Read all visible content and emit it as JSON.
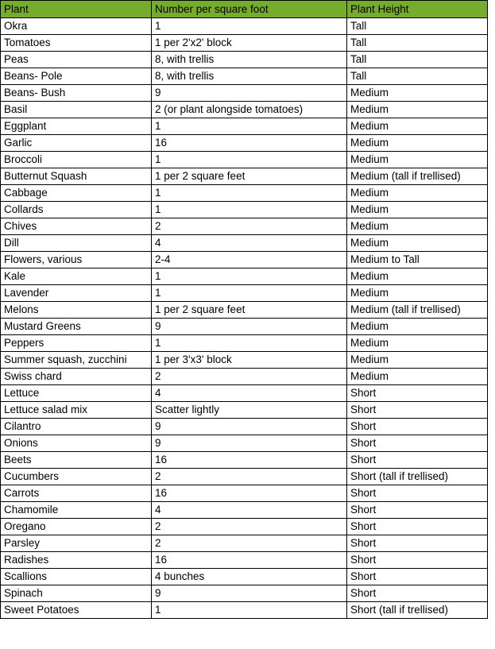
{
  "table": {
    "columns": [
      {
        "key": "plant",
        "label": "Plant"
      },
      {
        "key": "number",
        "label": "Number per square foot"
      },
      {
        "key": "height",
        "label": "Plant Height"
      }
    ],
    "header_background": "#76ac2c",
    "border_color": "#000000",
    "rows": [
      {
        "plant": "Okra",
        "number": "1",
        "height": "Tall"
      },
      {
        "plant": "Tomatoes",
        "number": "1 per 2'x2' block",
        "height": "Tall"
      },
      {
        "plant": "Peas",
        "number": "8, with trellis",
        "height": "Tall"
      },
      {
        "plant": "Beans- Pole",
        "number": "8, with trellis",
        "height": "Tall"
      },
      {
        "plant": "Beans- Bush",
        "number": "9",
        "height": "Medium"
      },
      {
        "plant": "Basil",
        "number": "2 (or plant alongside tomatoes)",
        "height": "Medium"
      },
      {
        "plant": "Eggplant",
        "number": "1",
        "height": "Medium"
      },
      {
        "plant": "Garlic",
        "number": "16",
        "height": "Medium"
      },
      {
        "plant": "Broccoli",
        "number": "1",
        "height": "Medium"
      },
      {
        "plant": "Butternut Squash",
        "number": "1 per 2 square feet",
        "height": "Medium (tall if trellised)"
      },
      {
        "plant": "Cabbage",
        "number": "1",
        "height": "Medium"
      },
      {
        "plant": "Collards",
        "number": "1",
        "height": "Medium"
      },
      {
        "plant": "Chives",
        "number": "2",
        "height": "Medium"
      },
      {
        "plant": "Dill",
        "number": "4",
        "height": "Medium"
      },
      {
        "plant": "Flowers, various",
        "number": "2-4",
        "height": "Medium to Tall"
      },
      {
        "plant": "Kale",
        "number": "1",
        "height": "Medium"
      },
      {
        "plant": "Lavender",
        "number": "1",
        "height": "Medium"
      },
      {
        "plant": "Melons",
        "number": "1 per 2 square feet",
        "height": "Medium (tall if trellised)"
      },
      {
        "plant": "Mustard Greens",
        "number": "9",
        "height": "Medium"
      },
      {
        "plant": "Peppers",
        "number": "1",
        "height": "Medium"
      },
      {
        "plant": "Summer squash, zucchini",
        "number": "1 per 3'x3' block",
        "height": "Medium"
      },
      {
        "plant": "Swiss chard",
        "number": "2",
        "height": "Medium"
      },
      {
        "plant": "Lettuce",
        "number": "4",
        "height": "Short"
      },
      {
        "plant": "Lettuce salad mix",
        "number": "Scatter lightly",
        "height": "Short"
      },
      {
        "plant": "Cilantro",
        "number": "9",
        "height": "Short"
      },
      {
        "plant": "Onions",
        "number": "9",
        "height": "Short"
      },
      {
        "plant": "Beets",
        "number": "16",
        "height": "Short"
      },
      {
        "plant": "Cucumbers",
        "number": "2",
        "height": "Short (tall if trellised)"
      },
      {
        "plant": "Carrots",
        "number": "16",
        "height": "Short"
      },
      {
        "plant": "Chamomile",
        "number": "4",
        "height": "Short"
      },
      {
        "plant": "Oregano",
        "number": "2",
        "height": "Short"
      },
      {
        "plant": "Parsley",
        "number": "2",
        "height": "Short"
      },
      {
        "plant": "Radishes",
        "number": "16",
        "height": "Short"
      },
      {
        "plant": "Scallions",
        "number": "4 bunches",
        "height": "Short"
      },
      {
        "plant": "Spinach",
        "number": "9",
        "height": "Short"
      },
      {
        "plant": "Sweet Potatoes",
        "number": "1",
        "height": "Short (tall if trellised)"
      }
    ]
  }
}
